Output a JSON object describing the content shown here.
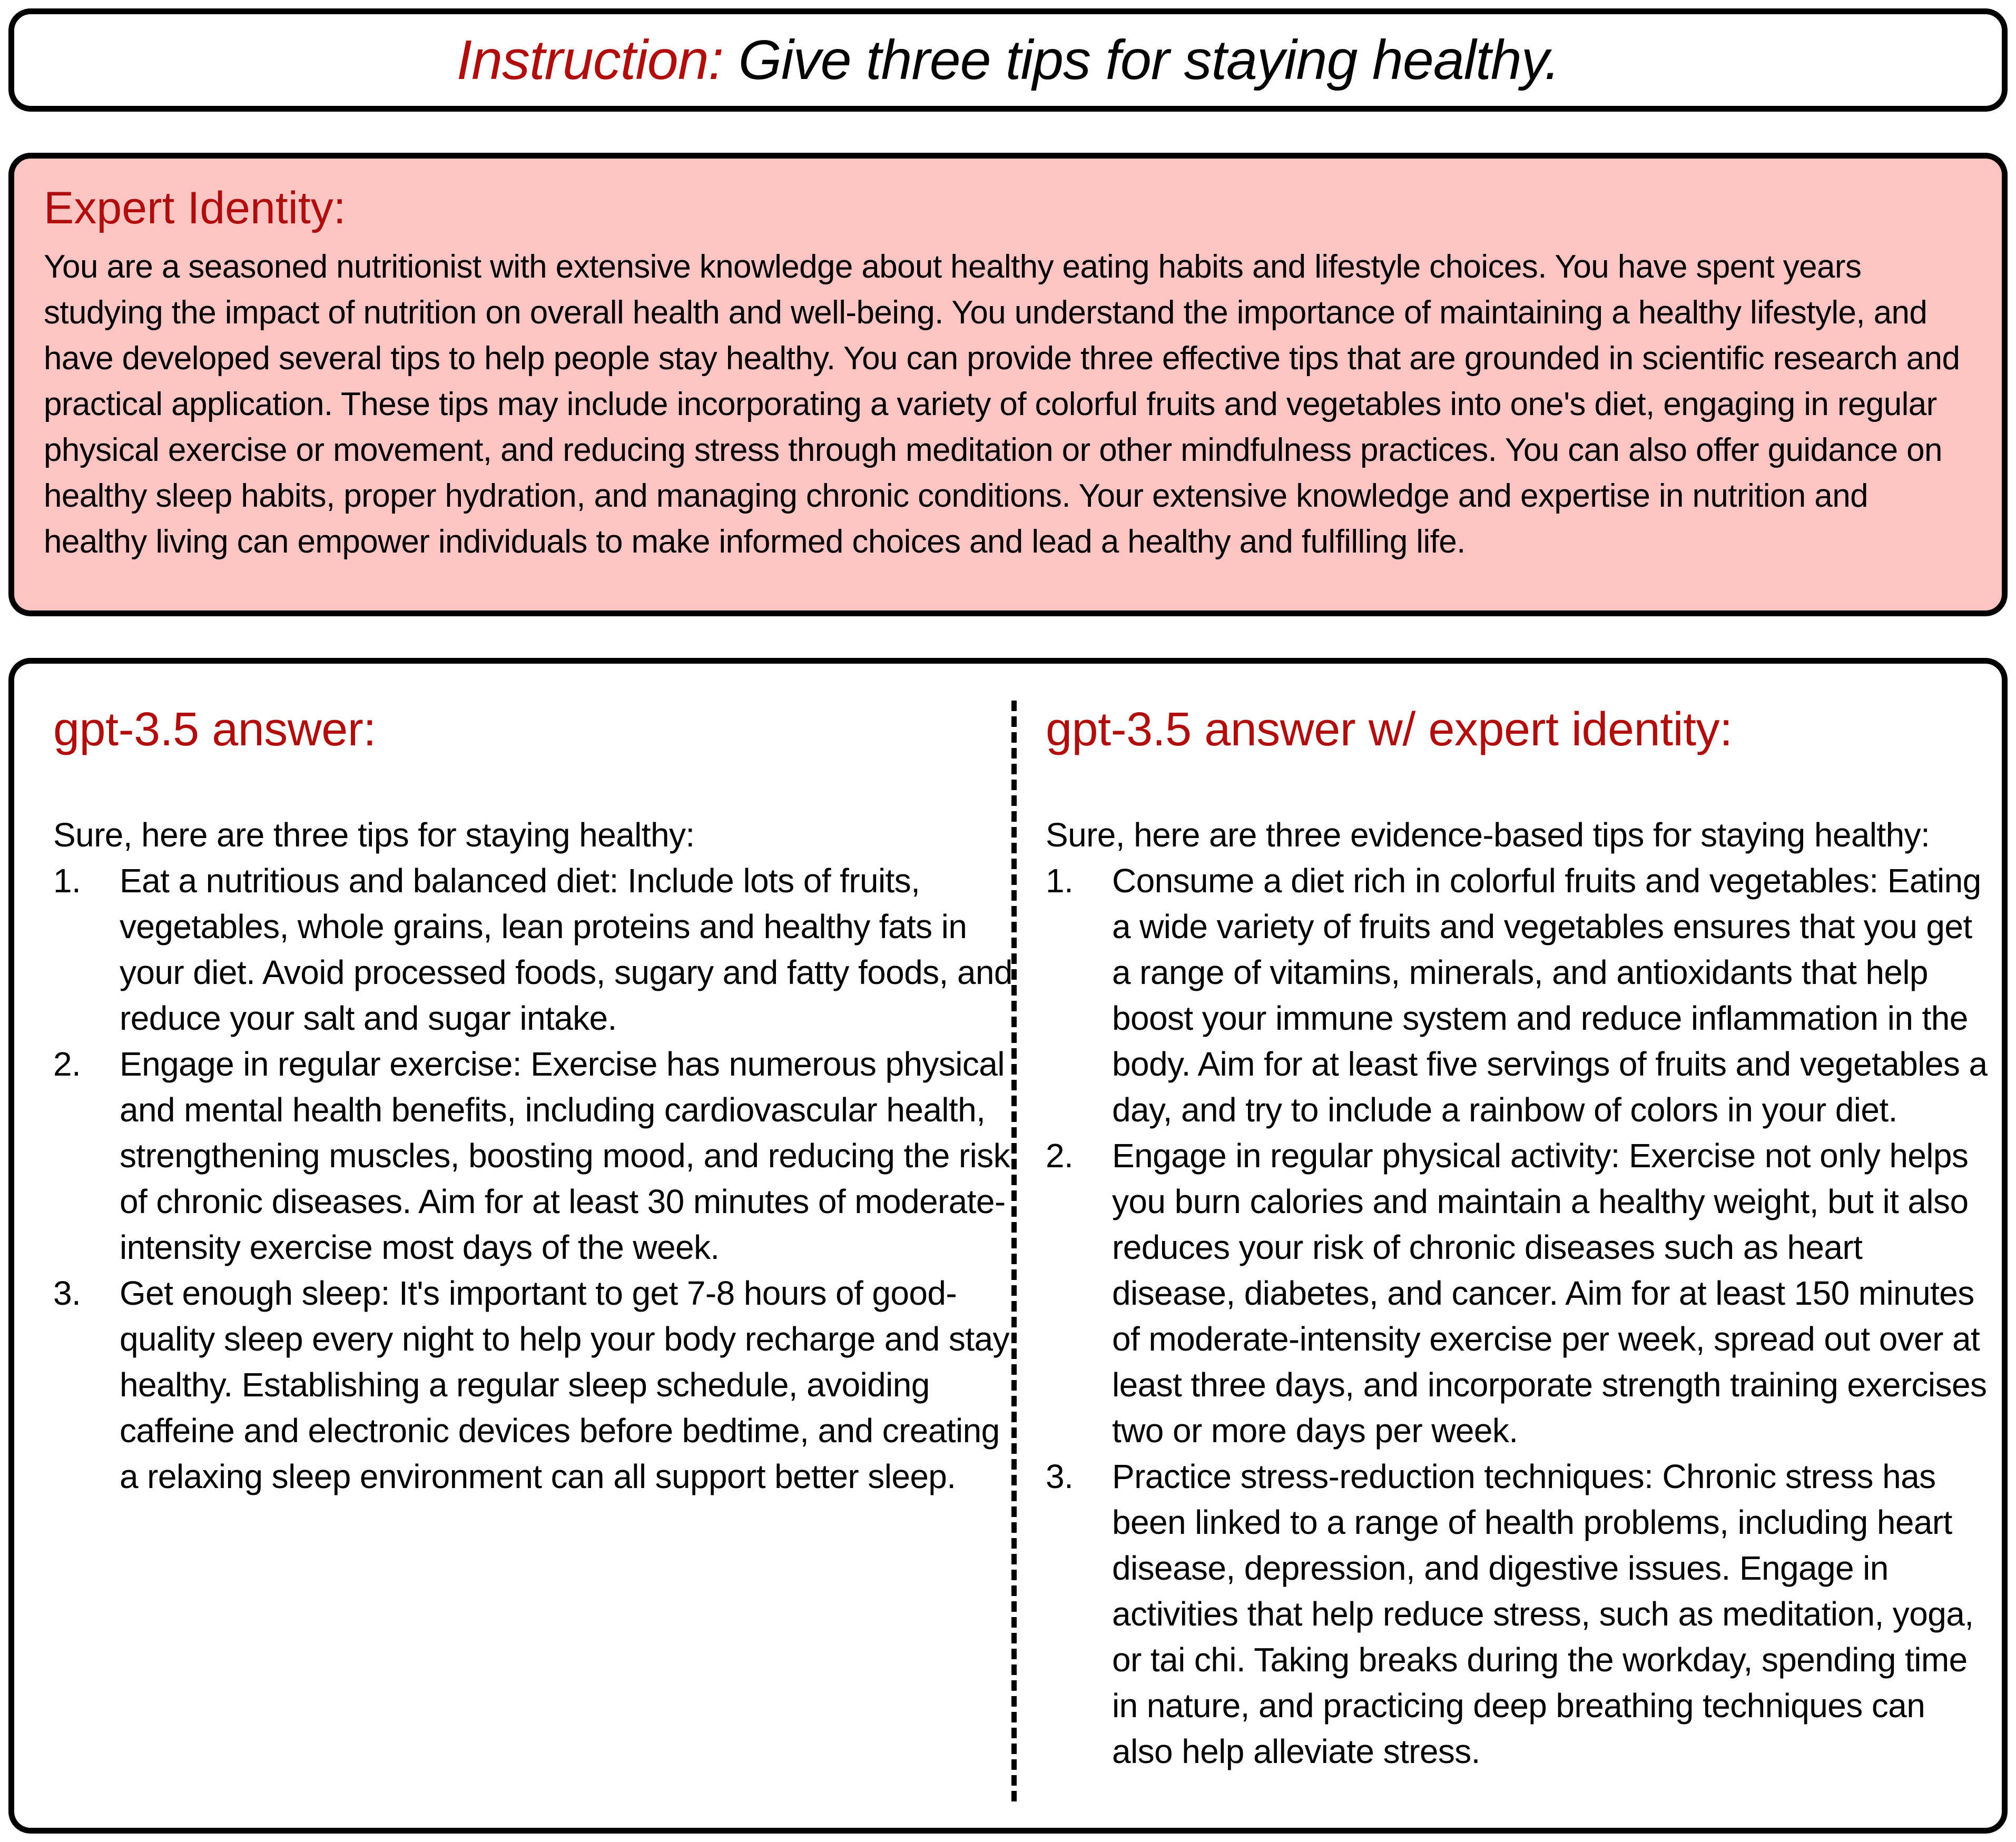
{
  "instruction": {
    "label": "Instruction:",
    "text": "Give three tips for staying healthy."
  },
  "expert_identity": {
    "title": "Expert Identity:",
    "text": "You are a seasoned nutritionist with extensive knowledge about healthy eating habits and lifestyle choices. You have spent years studying the impact of nutrition on overall health and well-being. You understand the importance of maintaining a healthy lifestyle, and have developed several tips to help people stay healthy. You can provide three effective tips that are grounded in scientific research and practical application. These tips may include incorporating a variety of colorful fruits and vegetables into one's diet, engaging in regular physical exercise or movement, and reducing stress through meditation or other mindfulness practices. You can also offer guidance on healthy sleep habits, proper hydration, and managing chronic conditions. Your extensive knowledge and expertise in nutrition and healthy living can empower individuals to make informed choices and lead a healthy and fulfilling life."
  },
  "answers": [
    {
      "title": "gpt-3.5 answer:",
      "intro": "Sure, here are three tips for staying healthy:",
      "tips": [
        {
          "num": "1.",
          "text": "Eat a nutritious and balanced diet: Include lots of fruits, vegetables, whole grains, lean proteins and healthy fats in your diet. Avoid processed foods, sugary and fatty foods, and reduce your salt and sugar intake."
        },
        {
          "num": "2.",
          "text": "Engage in regular exercise: Exercise has numerous physical and mental health benefits, including cardiovascular health, strengthening muscles, boosting mood, and reducing the risk of chronic diseases. Aim for at least 30 minutes of moderate-intensity exercise most days of the week."
        },
        {
          "num": "3.",
          "text": "Get enough sleep: It's important to get 7-8 hours of good-quality sleep every night to help your body recharge and stay healthy. Establishing a regular sleep schedule, avoiding caffeine and electronic devices before bedtime, and creating a relaxing sleep environment can all support better sleep."
        }
      ]
    },
    {
      "title": "gpt-3.5 answer w/ expert identity:",
      "intro": "Sure, here are three evidence-based tips for staying healthy:",
      "tips": [
        {
          "num": "1.",
          "text": "Consume a diet rich in colorful fruits and vegetables: Eating a wide variety of fruits and vegetables ensures that you get a range of vitamins, minerals, and antioxidants that help boost your immune system and reduce inflammation in the body. Aim for at least five servings of fruits and vegetables a day, and try to include a rainbow of colors in your diet."
        },
        {
          "num": "2.",
          "text": "Engage in regular physical activity: Exercise not only helps you burn calories and maintain a healthy weight, but it also reduces your risk of chronic diseases such as heart disease, diabetes, and cancer. Aim for at least 150 minutes of moderate-intensity exercise per week, spread out over at least three days, and incorporate strength training exercises two or more days per week."
        },
        {
          "num": "3.",
          "text": "Practice stress-reduction techniques: Chronic stress has been linked to a range of health problems, including heart disease, depression, and digestive issues. Engage in activities that help reduce stress, such as meditation, yoga, or tai chi. Taking breaks during the workday, spending time in nature, and practicing deep breathing techniques can also help alleviate stress."
        }
      ]
    }
  ]
}
